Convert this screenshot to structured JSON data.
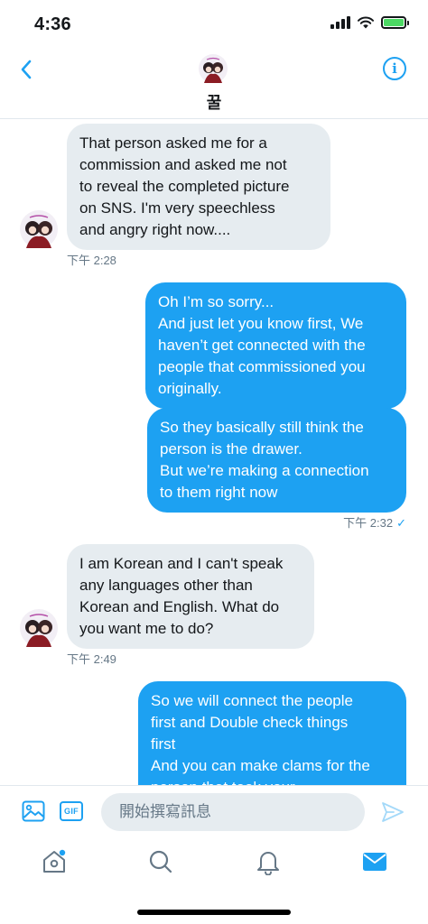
{
  "status_bar": {
    "time": "4:36"
  },
  "header": {
    "contact_name": "꿀"
  },
  "messages": [
    {
      "direction": "incoming",
      "lines": [
        "That person asked me for a",
        "commission and asked me not",
        "to reveal the completed picture",
        "on SNS. I'm very speechless",
        "and angry right now...."
      ],
      "time": "下午 2:28"
    },
    {
      "direction": "outgoing",
      "lines": [
        "Oh I’m so sorry...",
        "And just let you know first, We",
        "haven’t get connected with the",
        "people that commissioned you",
        "originally."
      ]
    },
    {
      "direction": "outgoing",
      "lines": [
        "So they basically still think the",
        "person is the drawer.",
        "But we’re making a connection",
        "to them right now"
      ],
      "time": "下午 2:32"
    },
    {
      "direction": "incoming",
      "lines": [
        "I am Korean and I can't speak",
        "any languages other than",
        "Korean and English. What do",
        "you want me to do?"
      ],
      "time": "下午 2:49"
    },
    {
      "direction": "outgoing",
      "lines": [
        "So we will connect the people",
        "first and Double check things",
        "first",
        "And you can make clams for the",
        "person that took your"
      ]
    }
  ],
  "composer": {
    "gif_label": "GIF",
    "placeholder": "開始撰寫訊息"
  },
  "colors": {
    "accent": "#1da1f2",
    "incoming_bubble": "#e6ecf0",
    "text_secondary": "#657786"
  },
  "icons": {
    "back": "chevron-left-icon",
    "info": "info-icon",
    "image": "image-icon",
    "gif": "gif-icon",
    "send": "send-icon",
    "home": "home-icon",
    "search": "search-icon",
    "notifications": "bell-icon",
    "messages": "mail-icon"
  }
}
